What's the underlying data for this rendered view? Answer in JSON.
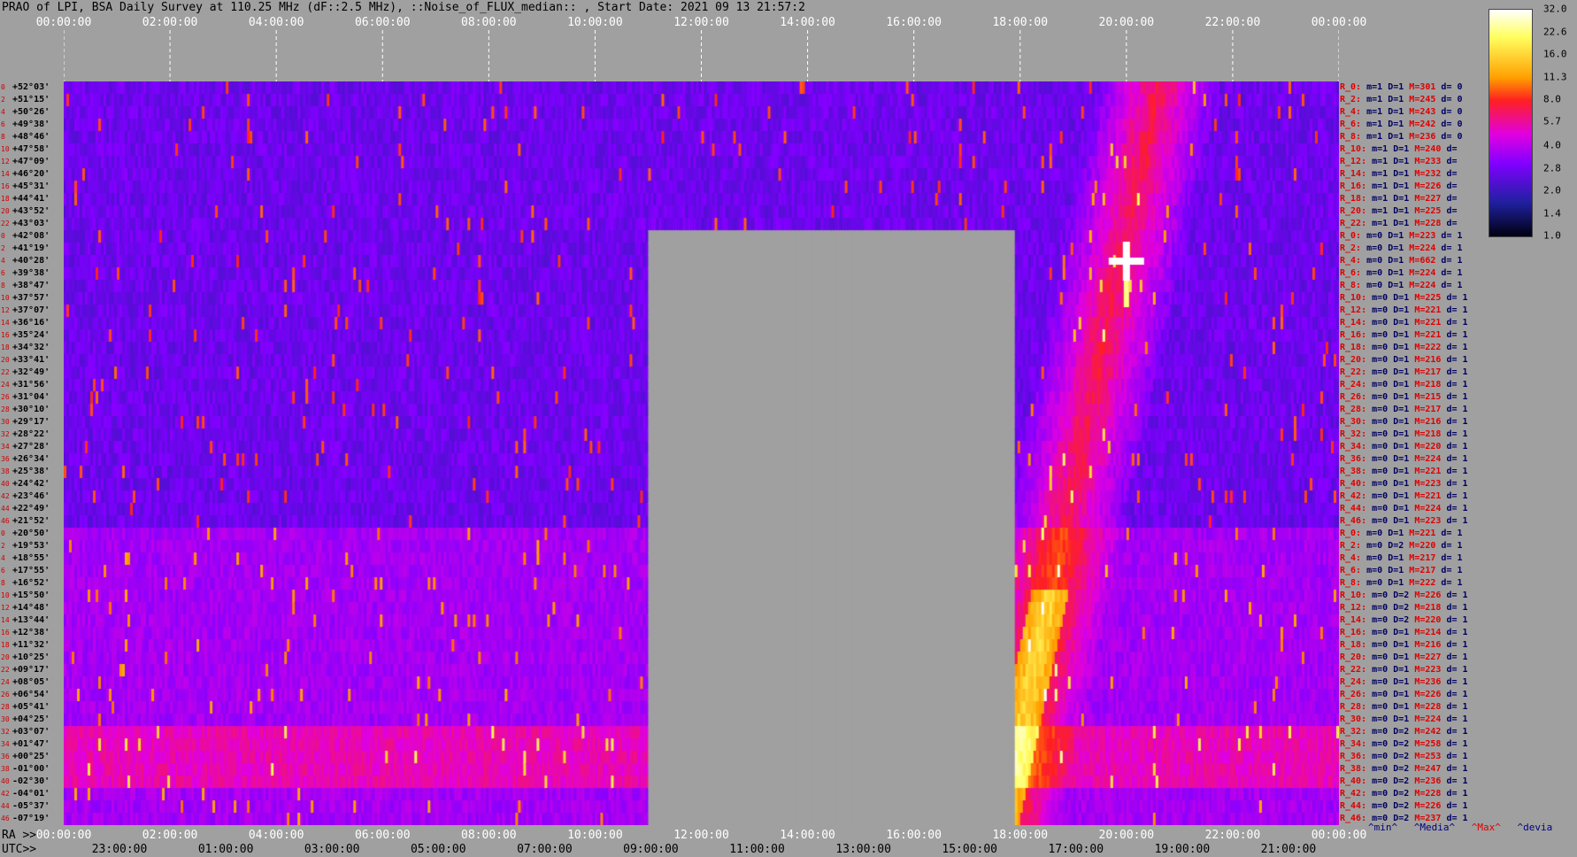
{
  "title": "PRAO of LPI, BSA Daily Survey at 110.25 MHz (dF::2.5 MHz), ::Noise_of_FLUX_median:: , Start Date: 2021 09 13 21:57:2",
  "axis_top": {
    "ticks": [
      "00:00:00",
      "02:00:00",
      "04:00:00",
      "06:00:00",
      "08:00:00",
      "10:00:00",
      "12:00:00",
      "14:00:00",
      "16:00:00",
      "18:00:00",
      "20:00:00",
      "22:00:00",
      "00:00:00"
    ],
    "color": "#ffffff"
  },
  "axis_bottom": {
    "ra_prefix": "RA >>",
    "utc_prefix": "UTC>>",
    "ra_ticks": [
      "00:00:00",
      "02:00:00",
      "04:00:00",
      "06:00:00",
      "08:00:00",
      "10:00:00",
      "12:00:00",
      "14:00:00",
      "16:00:00",
      "18:00:00",
      "20:00:00",
      "22:00:00",
      "00:00:00"
    ],
    "utc_ticks": [
      "23:00:00",
      "01:00:00",
      "03:00:00",
      "05:00:00",
      "07:00:00",
      "09:00:00",
      "11:00:00",
      "13:00:00",
      "15:00:00",
      "17:00:00",
      "19:00:00",
      "21:00:00"
    ],
    "ra_color": "#ffffff",
    "utc_color": "#000000"
  },
  "declinations": [
    {
      "idx": "0",
      "dec": "+52°03'"
    },
    {
      "idx": "2",
      "dec": "+51°15'"
    },
    {
      "idx": "4",
      "dec": "+50°26'"
    },
    {
      "idx": "6",
      "dec": "+49°38'"
    },
    {
      "idx": "8",
      "dec": "+48°46'"
    },
    {
      "idx": "10",
      "dec": "+47°58'"
    },
    {
      "idx": "12",
      "dec": "+47°09'"
    },
    {
      "idx": "14",
      "dec": "+46°20'"
    },
    {
      "idx": "16",
      "dec": "+45°31'"
    },
    {
      "idx": "18",
      "dec": "+44°41'"
    },
    {
      "idx": "20",
      "dec": "+43°52'"
    },
    {
      "idx": "22",
      "dec": "+43°03'"
    },
    {
      "idx": "0",
      "dec": "+42°08'"
    },
    {
      "idx": "2",
      "dec": "+41°19'"
    },
    {
      "idx": "4",
      "dec": "+40°28'"
    },
    {
      "idx": "6",
      "dec": "+39°38'"
    },
    {
      "idx": "8",
      "dec": "+38°47'"
    },
    {
      "idx": "10",
      "dec": "+37°57'"
    },
    {
      "idx": "12",
      "dec": "+37°07'"
    },
    {
      "idx": "14",
      "dec": "+36°16'"
    },
    {
      "idx": "16",
      "dec": "+35°24'"
    },
    {
      "idx": "18",
      "dec": "+34°32'"
    },
    {
      "idx": "20",
      "dec": "+33°41'"
    },
    {
      "idx": "22",
      "dec": "+32°49'"
    },
    {
      "idx": "24",
      "dec": "+31°56'"
    },
    {
      "idx": "26",
      "dec": "+31°04'"
    },
    {
      "idx": "28",
      "dec": "+30°10'"
    },
    {
      "idx": "30",
      "dec": "+29°17'"
    },
    {
      "idx": "32",
      "dec": "+28°22'"
    },
    {
      "idx": "34",
      "dec": "+27°28'"
    },
    {
      "idx": "36",
      "dec": "+26°34'"
    },
    {
      "idx": "38",
      "dec": "+25°38'"
    },
    {
      "idx": "40",
      "dec": "+24°42'"
    },
    {
      "idx": "42",
      "dec": "+23°46'"
    },
    {
      "idx": "44",
      "dec": "+22°49'"
    },
    {
      "idx": "46",
      "dec": "+21°52'"
    },
    {
      "idx": "0",
      "dec": "+20°50'"
    },
    {
      "idx": "2",
      "dec": "+19°53'"
    },
    {
      "idx": "4",
      "dec": "+18°55'"
    },
    {
      "idx": "6",
      "dec": "+17°55'"
    },
    {
      "idx": "8",
      "dec": "+16°52'"
    },
    {
      "idx": "10",
      "dec": "+15°50'"
    },
    {
      "idx": "12",
      "dec": "+14°48'"
    },
    {
      "idx": "14",
      "dec": "+13°44'"
    },
    {
      "idx": "16",
      "dec": "+12°38'"
    },
    {
      "idx": "18",
      "dec": "+11°32'"
    },
    {
      "idx": "20",
      "dec": "+10°25'"
    },
    {
      "idx": "22",
      "dec": "+09°17'"
    },
    {
      "idx": "24",
      "dec": "+08°05'"
    },
    {
      "idx": "26",
      "dec": "+06°54'"
    },
    {
      "idx": "28",
      "dec": "+05°41'"
    },
    {
      "idx": "30",
      "dec": "+04°25'"
    },
    {
      "idx": "32",
      "dec": "+03°07'"
    },
    {
      "idx": "34",
      "dec": "+01°47'"
    },
    {
      "idx": "36",
      "dec": "+00°25'"
    },
    {
      "idx": "38",
      "dec": "-01°00'"
    },
    {
      "idx": "40",
      "dec": "-02°30'"
    },
    {
      "idx": "42",
      "dec": "-04°01'"
    },
    {
      "idx": "44",
      "dec": "-05°37'"
    },
    {
      "idx": "46",
      "dec": "-07°19'"
    }
  ],
  "stats": [
    {
      "r": "R_0:",
      "m": "m=1",
      "D": "D=1",
      "M": "M=301",
      "d": "d= 0"
    },
    {
      "r": "R_2:",
      "m": "m=1",
      "D": "D=1",
      "M": "M=245",
      "d": "d= 0"
    },
    {
      "r": "R_4:",
      "m": "m=1",
      "D": "D=1",
      "M": "M=243",
      "d": "d= 0"
    },
    {
      "r": "R_6:",
      "m": "m=1",
      "D": "D=1",
      "M": "M=242",
      "d": "d= 0"
    },
    {
      "r": "R_8:",
      "m": "m=1",
      "D": "D=1",
      "M": "M=236",
      "d": "d= 0"
    },
    {
      "r": "R_10:",
      "m": "m=1",
      "D": "D=1",
      "M": "M=240",
      "d": "d="
    },
    {
      "r": "R_12:",
      "m": "m=1",
      "D": "D=1",
      "M": "M=233",
      "d": "d="
    },
    {
      "r": "R_14:",
      "m": "m=1",
      "D": "D=1",
      "M": "M=232",
      "d": "d="
    },
    {
      "r": "R_16:",
      "m": "m=1",
      "D": "D=1",
      "M": "M=226",
      "d": "d="
    },
    {
      "r": "R_18:",
      "m": "m=1",
      "D": "D=1",
      "M": "M=227",
      "d": "d="
    },
    {
      "r": "R_20:",
      "m": "m=1",
      "D": "D=1",
      "M": "M=225",
      "d": "d="
    },
    {
      "r": "R_22:",
      "m": "m=1",
      "D": "D=1",
      "M": "M=228",
      "d": "d="
    },
    {
      "r": "R_0:",
      "m": "m=0",
      "D": "D=1",
      "M": "M=223",
      "d": "d= 1"
    },
    {
      "r": "R_2:",
      "m": "m=0",
      "D": "D=1",
      "M": "M=224",
      "d": "d= 1"
    },
    {
      "r": "R_4:",
      "m": "m=0",
      "D": "D=1",
      "M": "M=662",
      "d": "d= 1"
    },
    {
      "r": "R_6:",
      "m": "m=0",
      "D": "D=1",
      "M": "M=224",
      "d": "d= 1"
    },
    {
      "r": "R_8:",
      "m": "m=0",
      "D": "D=1",
      "M": "M=224",
      "d": "d= 1"
    },
    {
      "r": "R_10:",
      "m": "m=0",
      "D": "D=1",
      "M": "M=225",
      "d": "d= 1"
    },
    {
      "r": "R_12:",
      "m": "m=0",
      "D": "D=1",
      "M": "M=221",
      "d": "d= 1"
    },
    {
      "r": "R_14:",
      "m": "m=0",
      "D": "D=1",
      "M": "M=221",
      "d": "d= 1"
    },
    {
      "r": "R_16:",
      "m": "m=0",
      "D": "D=1",
      "M": "M=221",
      "d": "d= 1"
    },
    {
      "r": "R_18:",
      "m": "m=0",
      "D": "D=1",
      "M": "M=222",
      "d": "d= 1"
    },
    {
      "r": "R_20:",
      "m": "m=0",
      "D": "D=1",
      "M": "M=216",
      "d": "d= 1"
    },
    {
      "r": "R_22:",
      "m": "m=0",
      "D": "D=1",
      "M": "M=217",
      "d": "d= 1"
    },
    {
      "r": "R_24:",
      "m": "m=0",
      "D": "D=1",
      "M": "M=218",
      "d": "d= 1"
    },
    {
      "r": "R_26:",
      "m": "m=0",
      "D": "D=1",
      "M": "M=215",
      "d": "d= 1"
    },
    {
      "r": "R_28:",
      "m": "m=0",
      "D": "D=1",
      "M": "M=217",
      "d": "d= 1"
    },
    {
      "r": "R_30:",
      "m": "m=0",
      "D": "D=1",
      "M": "M=216",
      "d": "d= 1"
    },
    {
      "r": "R_32:",
      "m": "m=0",
      "D": "D=1",
      "M": "M=218",
      "d": "d= 1"
    },
    {
      "r": "R_34:",
      "m": "m=0",
      "D": "D=1",
      "M": "M=220",
      "d": "d= 1"
    },
    {
      "r": "R_36:",
      "m": "m=0",
      "D": "D=1",
      "M": "M=224",
      "d": "d= 1"
    },
    {
      "r": "R_38:",
      "m": "m=0",
      "D": "D=1",
      "M": "M=221",
      "d": "d= 1"
    },
    {
      "r": "R_40:",
      "m": "m=0",
      "D": "D=1",
      "M": "M=223",
      "d": "d= 1"
    },
    {
      "r": "R_42:",
      "m": "m=0",
      "D": "D=1",
      "M": "M=221",
      "d": "d= 1"
    },
    {
      "r": "R_44:",
      "m": "m=0",
      "D": "D=1",
      "M": "M=224",
      "d": "d= 1"
    },
    {
      "r": "R_46:",
      "m": "m=0",
      "D": "D=1",
      "M": "M=223",
      "d": "d= 1"
    },
    {
      "r": "R_0:",
      "m": "m=0",
      "D": "D=1",
      "M": "M=221",
      "d": "d= 1"
    },
    {
      "r": "R_2:",
      "m": "m=0",
      "D": "D=2",
      "M": "M=220",
      "d": "d= 1"
    },
    {
      "r": "R_4:",
      "m": "m=0",
      "D": "D=1",
      "M": "M=217",
      "d": "d= 1"
    },
    {
      "r": "R_6:",
      "m": "m=0",
      "D": "D=1",
      "M": "M=217",
      "d": "d= 1"
    },
    {
      "r": "R_8:",
      "m": "m=0",
      "D": "D=1",
      "M": "M=222",
      "d": "d= 1"
    },
    {
      "r": "R_10:",
      "m": "m=0",
      "D": "D=2",
      "M": "M=226",
      "d": "d= 1"
    },
    {
      "r": "R_12:",
      "m": "m=0",
      "D": "D=2",
      "M": "M=218",
      "d": "d= 1"
    },
    {
      "r": "R_14:",
      "m": "m=0",
      "D": "D=2",
      "M": "M=220",
      "d": "d= 1"
    },
    {
      "r": "R_16:",
      "m": "m=0",
      "D": "D=1",
      "M": "M=214",
      "d": "d= 1"
    },
    {
      "r": "R_18:",
      "m": "m=0",
      "D": "D=1",
      "M": "M=216",
      "d": "d= 1"
    },
    {
      "r": "R_20:",
      "m": "m=0",
      "D": "D=1",
      "M": "M=227",
      "d": "d= 1"
    },
    {
      "r": "R_22:",
      "m": "m=0",
      "D": "D=1",
      "M": "M=223",
      "d": "d= 1"
    },
    {
      "r": "R_24:",
      "m": "m=0",
      "D": "D=1",
      "M": "M=236",
      "d": "d= 1"
    },
    {
      "r": "R_26:",
      "m": "m=0",
      "D": "D=1",
      "M": "M=226",
      "d": "d= 1"
    },
    {
      "r": "R_28:",
      "m": "m=0",
      "D": "D=1",
      "M": "M=228",
      "d": "d= 1"
    },
    {
      "r": "R_30:",
      "m": "m=0",
      "D": "D=1",
      "M": "M=224",
      "d": "d= 1"
    },
    {
      "r": "R_32:",
      "m": "m=0",
      "D": "D=2",
      "M": "M=242",
      "d": "d= 1"
    },
    {
      "r": "R_34:",
      "m": "m=0",
      "D": "D=2",
      "M": "M=258",
      "d": "d= 1"
    },
    {
      "r": "R_36:",
      "m": "m=0",
      "D": "D=2",
      "M": "M=253",
      "d": "d= 1"
    },
    {
      "r": "R_38:",
      "m": "m=0",
      "D": "D=2",
      "M": "M=247",
      "d": "d= 1"
    },
    {
      "r": "R_40:",
      "m": "m=0",
      "D": "D=2",
      "M": "M=236",
      "d": "d= 1"
    },
    {
      "r": "R_42:",
      "m": "m=0",
      "D": "D=2",
      "M": "M=228",
      "d": "d= 1"
    },
    {
      "r": "R_44:",
      "m": "m=0",
      "D": "D=2",
      "M": "M=226",
      "d": "d= 1"
    },
    {
      "r": "R_46:",
      "m": "m=0",
      "D": "D=2",
      "M": "M=237",
      "d": "d= 1"
    }
  ],
  "legend": {
    "min": "^min^",
    "media": "^Media^",
    "max": "^Max^",
    "devia": "^devia"
  },
  "chart_data": {
    "type": "heatmap",
    "title": "PRAO of LPI, BSA Daily Survey at 110.25 MHz (dF::2.5 MHz), ::Noise_of_FLUX_median:: , Start Date: 2021 09 13 21:57:2",
    "x_ticks_ra": [
      "00:00:00",
      "02:00:00",
      "04:00:00",
      "06:00:00",
      "08:00:00",
      "10:00:00",
      "12:00:00",
      "14:00:00",
      "16:00:00",
      "18:00:00",
      "20:00:00",
      "22:00:00",
      "00:00:00"
    ],
    "x_ticks_utc": [
      "23:00:00",
      "01:00:00",
      "03:00:00",
      "05:00:00",
      "07:00:00",
      "09:00:00",
      "11:00:00",
      "13:00:00",
      "15:00:00",
      "17:00:00",
      "19:00:00",
      "21:00:00"
    ],
    "colorbar": {
      "ticks": [
        32.0,
        22.6,
        16.0,
        11.3,
        8.0,
        5.7,
        4.0,
        2.8,
        2.0,
        1.4,
        1.0
      ],
      "scale": "log",
      "colormap": [
        "#000010",
        "#2020a0",
        "#8000ff",
        "#e000e0",
        "#ff2020",
        "#ffa000",
        "#ffff60",
        "#ffffff"
      ]
    },
    "rows": 60,
    "gap": {
      "ra_start_h": 11.0,
      "ra_end_h": 17.9,
      "row_from": 12,
      "color": "#a0a0a0"
    },
    "bright_source": {
      "ra_h": 20.0,
      "row": 14
    }
  }
}
